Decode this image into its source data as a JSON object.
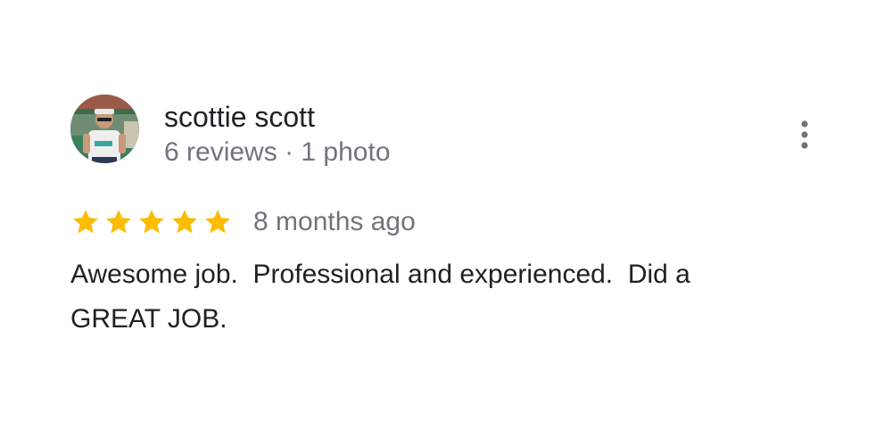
{
  "review": {
    "author": {
      "name": "scottie scott",
      "reviews_count": "6 reviews",
      "separator": "·",
      "photos_count": "1 photo",
      "avatar_icon": "profile-photo"
    },
    "menu_icon": "more-vertical-icon",
    "rating": {
      "value": 5,
      "max": 5,
      "star_color": "#fbbc04"
    },
    "time": "8 months ago",
    "text": "Awesome job.  Professional and experienced.  Did a\nGREAT JOB."
  }
}
